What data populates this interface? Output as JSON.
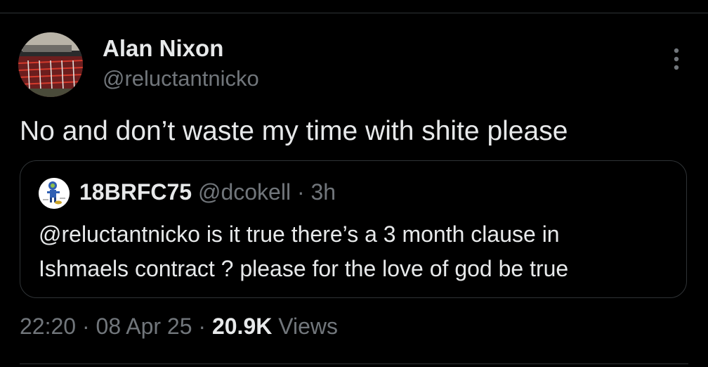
{
  "tweet": {
    "author_name": "Alan Nixon",
    "author_handle": "@reluctantnicko",
    "text": "No and don’t waste my time with shite please",
    "time": "22:20",
    "date": "08 Apr 25",
    "views_count": "20.9K",
    "views_label": "Views",
    "separator": "·"
  },
  "quoted_tweet": {
    "author_name": "18BRFC75",
    "author_handle": "@dcokell",
    "separator": "·",
    "time": "3h",
    "text_line1": "@reluctantnicko is it true there’s a 3 month clause in",
    "text_line2": "Ishmaels contract ? please for the love of god be true"
  },
  "icons": {
    "more": "more-vertical-icon"
  },
  "colors": {
    "background": "#000000",
    "primary_text": "#e7e9ea",
    "secondary_text": "#71767b",
    "border": "#2f3336"
  }
}
